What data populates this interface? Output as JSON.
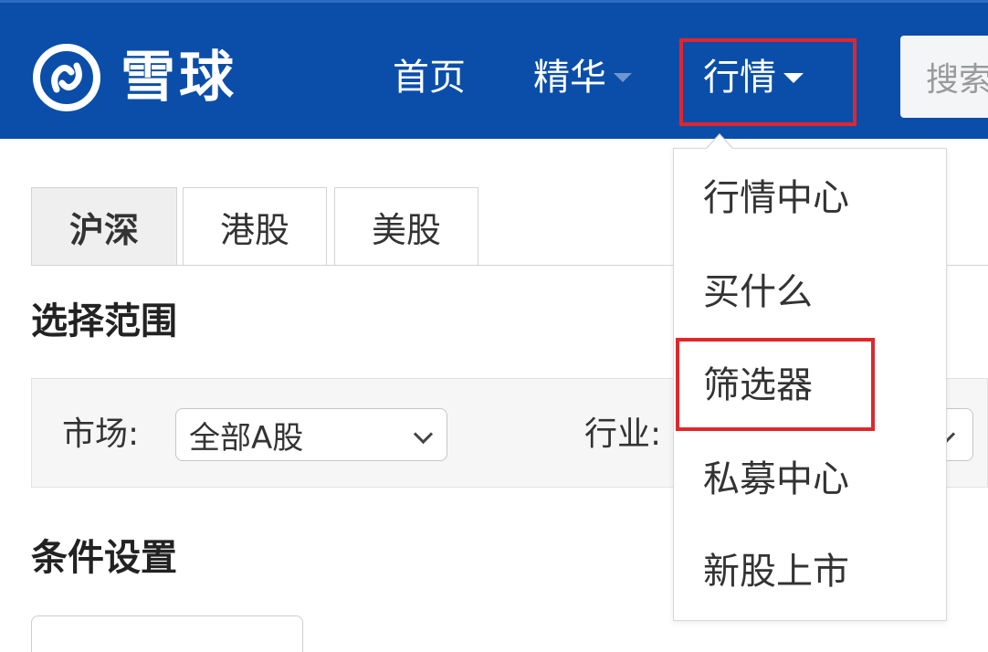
{
  "brand": {
    "name": "雪球",
    "background": "#0a4ea9"
  },
  "nav": {
    "home": "首页",
    "essence": "精华",
    "market": "行情"
  },
  "search": {
    "placeholder": "搜索"
  },
  "market_tabs": [
    {
      "label": "沪深",
      "selected": true
    },
    {
      "label": "港股",
      "selected": false
    },
    {
      "label": "美股",
      "selected": false
    }
  ],
  "range": {
    "title": "选择范围",
    "market_label": "市场:",
    "market_value": "全部A股",
    "industry_label": "行业:"
  },
  "conditions": {
    "title": "条件设置"
  },
  "dropdown": {
    "items": [
      {
        "label": "行情中心"
      },
      {
        "label": "买什么"
      },
      {
        "label": "筛选器",
        "highlighted": true
      },
      {
        "label": "私募中心"
      },
      {
        "label": "新股上市"
      }
    ]
  },
  "colors": {
    "highlight": "#e0262d",
    "nav_bar": "#0a4ea9",
    "selected_tab": "#efefef"
  }
}
